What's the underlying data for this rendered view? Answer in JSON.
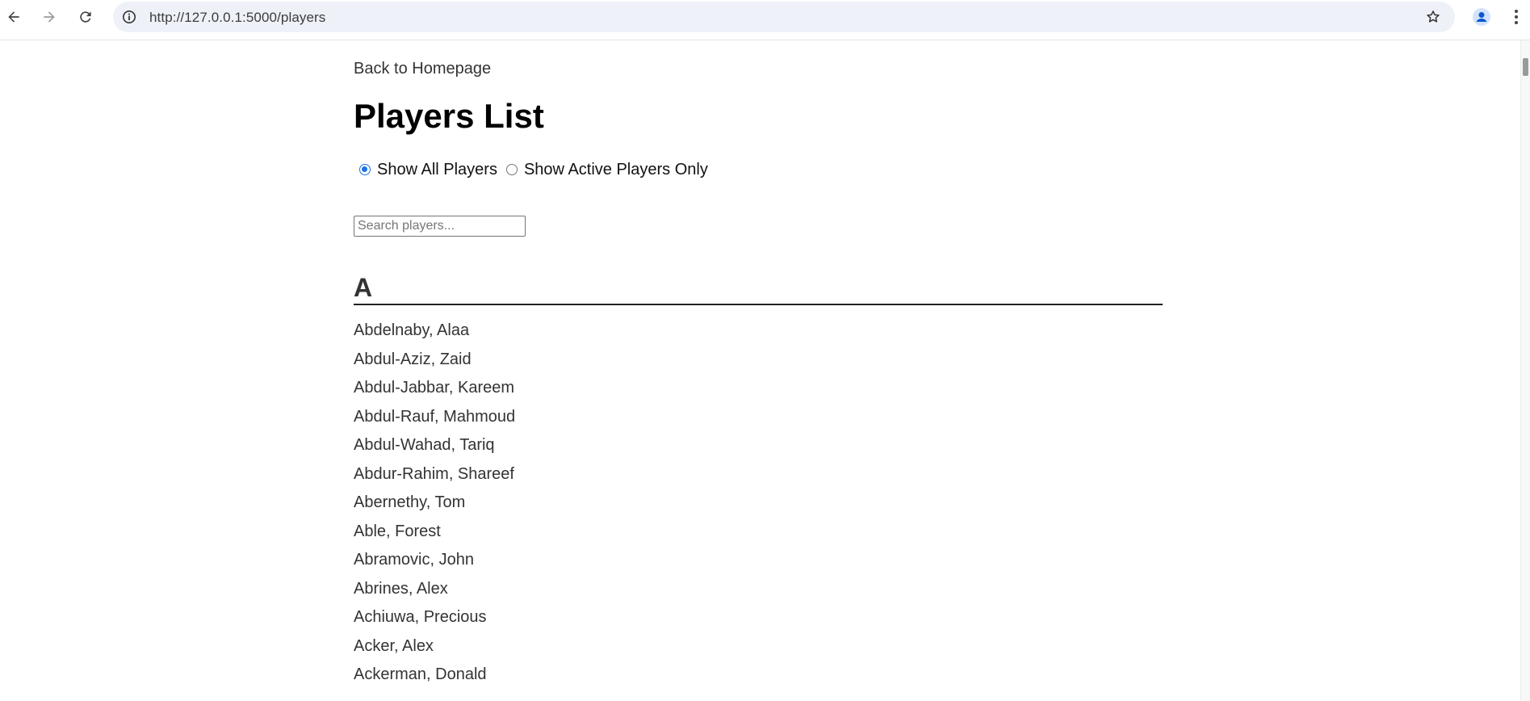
{
  "browser": {
    "url": "http://127.0.0.1:5000/players"
  },
  "page": {
    "back_link": "Back to Homepage",
    "title": "Players List",
    "filters": [
      {
        "label": "Show All Players",
        "checked": true
      },
      {
        "label": "Show Active Players Only",
        "checked": false
      }
    ],
    "search": {
      "placeholder": "Search players...",
      "value": ""
    },
    "section": {
      "letter": "A",
      "players": [
        "Abdelnaby, Alaa",
        "Abdul-Aziz, Zaid",
        "Abdul-Jabbar, Kareem",
        "Abdul-Rauf, Mahmoud",
        "Abdul-Wahad, Tariq",
        "Abdur-Rahim, Shareef",
        "Abernethy, Tom",
        "Able, Forest",
        "Abramovic, John",
        "Abrines, Alex",
        "Achiuwa, Precious",
        "Acker, Alex",
        "Ackerman, Donald"
      ]
    }
  },
  "colors": {
    "accent": "#1a73e8",
    "text": "#333333",
    "omnibox_bg": "#eef1f8"
  }
}
